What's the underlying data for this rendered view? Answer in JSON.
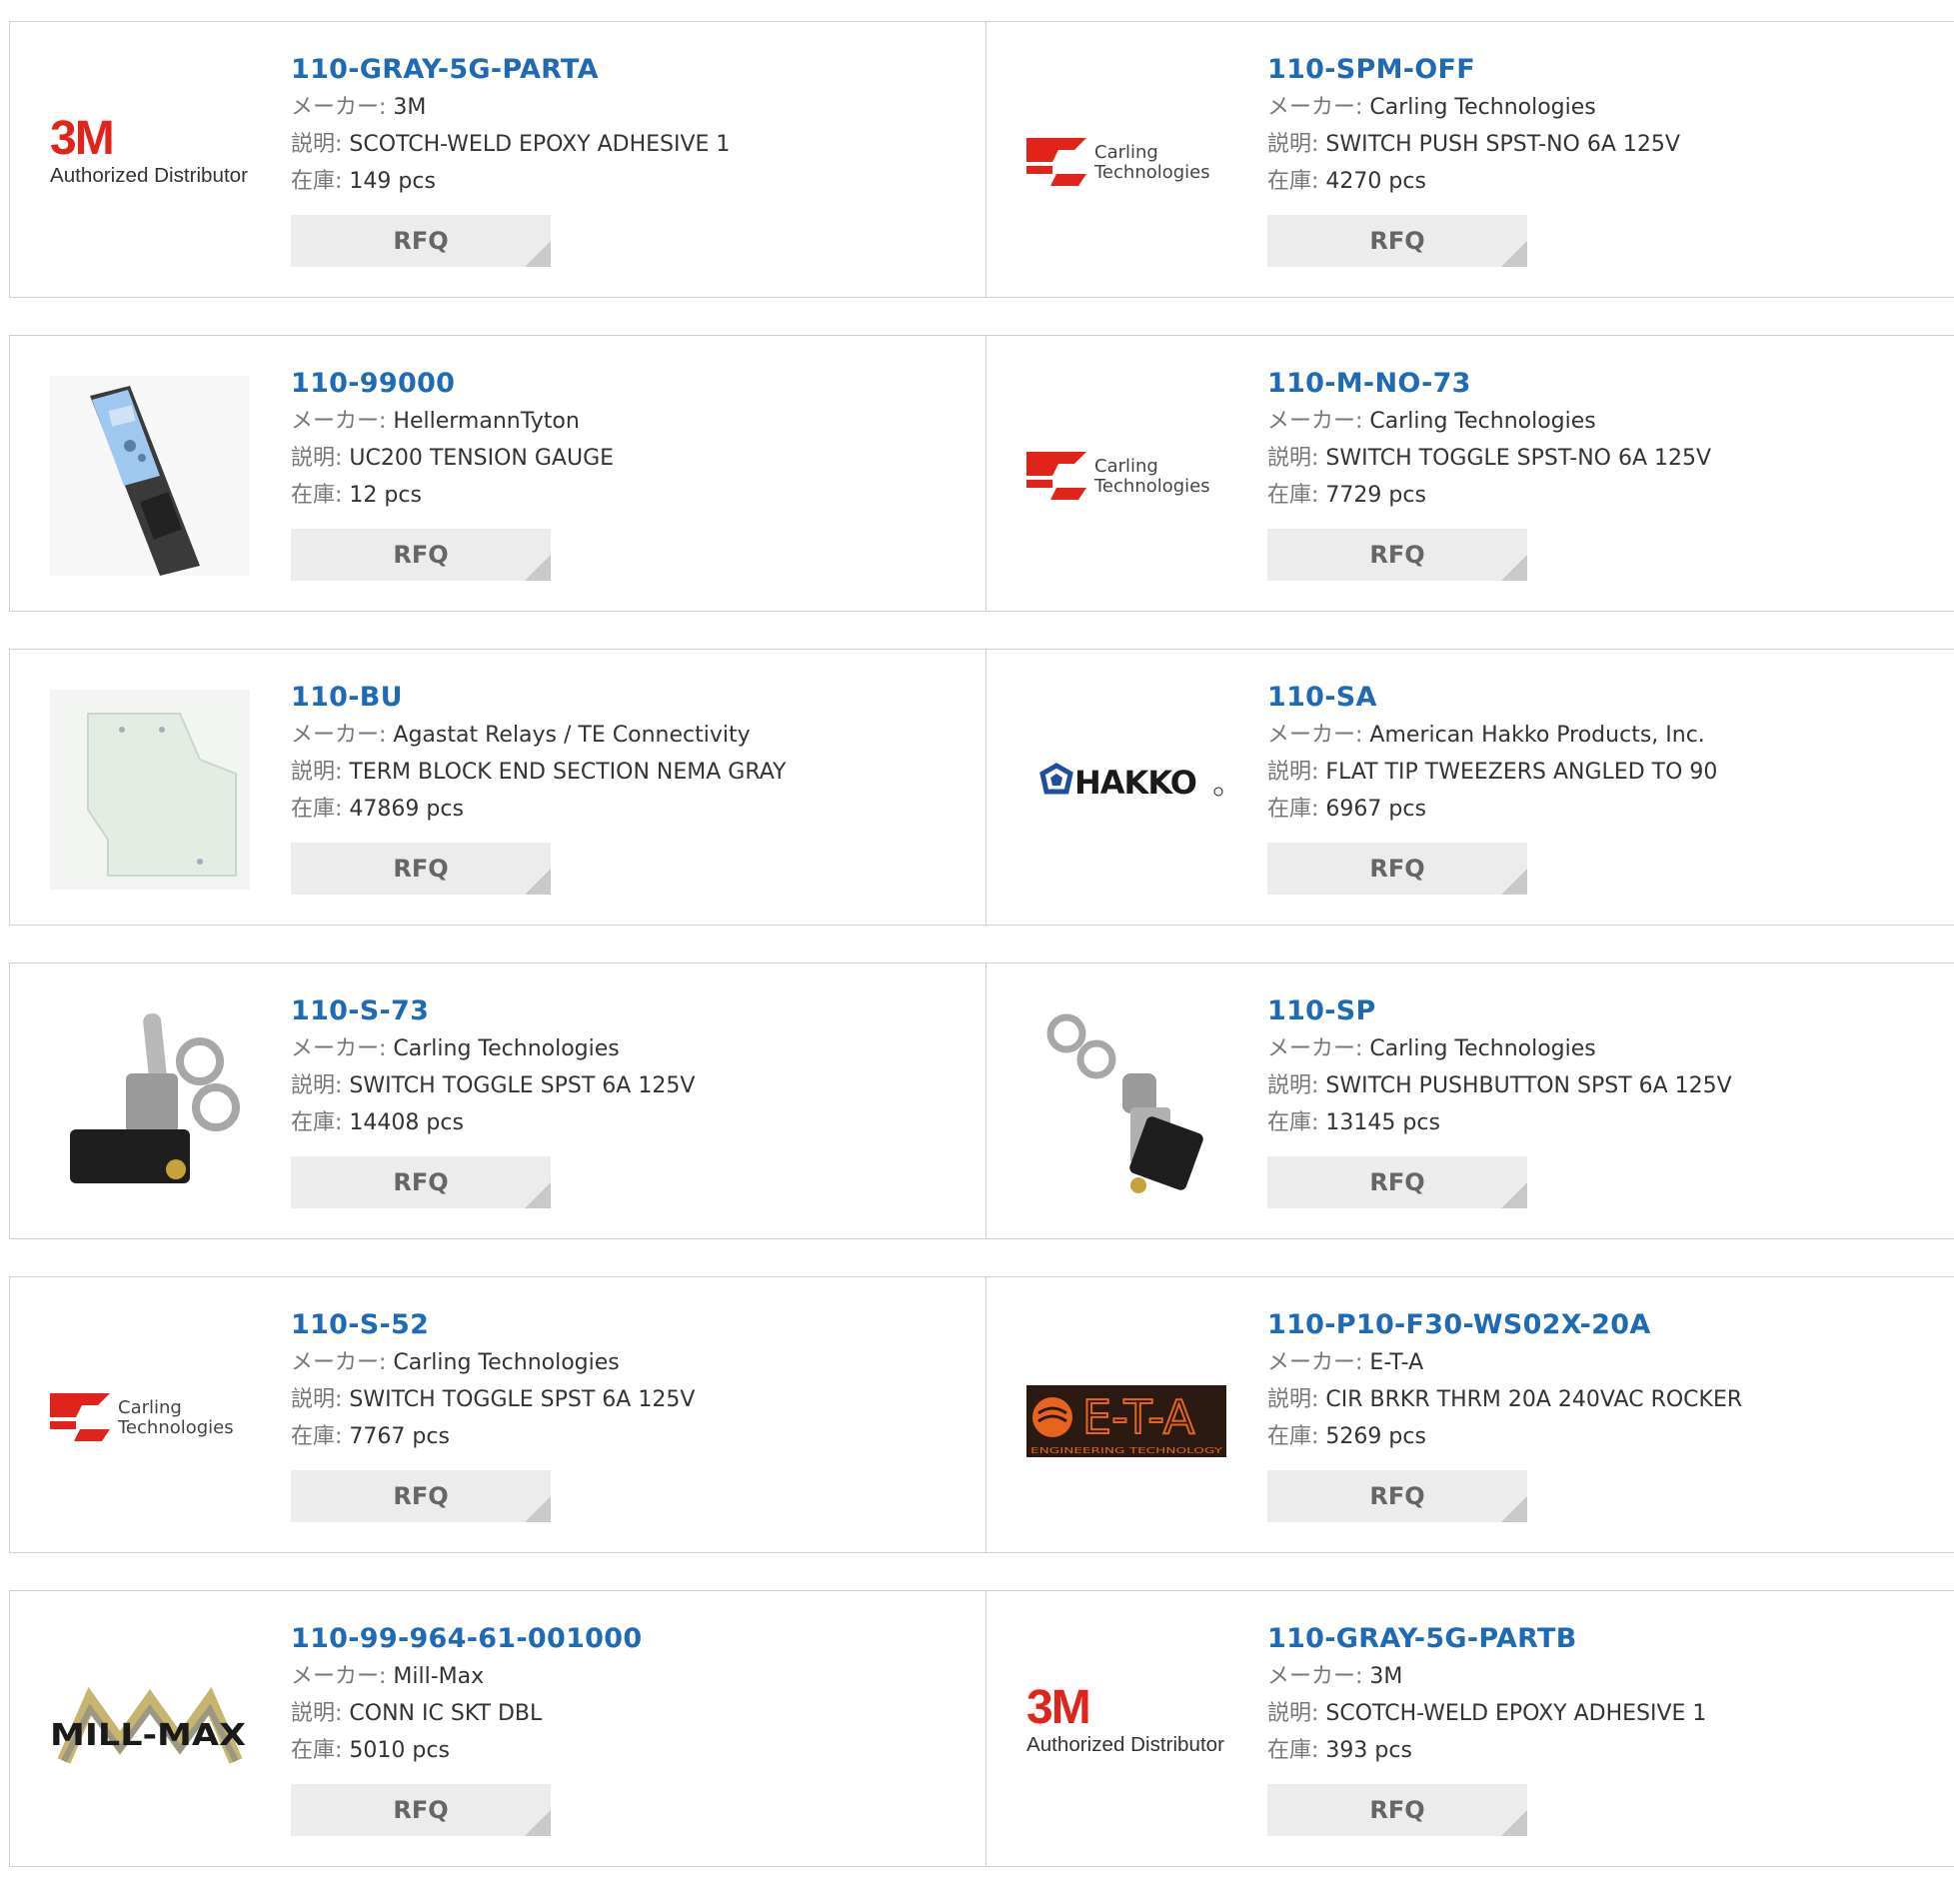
{
  "labels": {
    "maker": "メーカー:",
    "desc": "説明:",
    "stock": "在庫:",
    "rfq": "RFQ"
  },
  "logo_text": {
    "m3": "3M",
    "m3_sub": "Authorized Distributor",
    "carling1": "Carling",
    "carling2": "Technologies",
    "hakko": "HAKKO",
    "eta": "E-T-A",
    "eta_sub": "ENGINEERING TECHNOLOGY",
    "millmax": "MILL-MAX"
  },
  "products": [
    {
      "part": "110-GRAY-5G-PARTA",
      "maker": "3M",
      "desc": "SCOTCH-WELD EPOXY ADHESIVE 1",
      "stock": "149 pcs",
      "image": "3m-logo"
    },
    {
      "part": "110-SPM-OFF",
      "maker": "Carling Technologies",
      "desc": "SWITCH PUSH SPST-NO 6A 125V",
      "stock": "4270 pcs",
      "image": "carling-logo"
    },
    {
      "part": "110-99000",
      "maker": "HellermannTyton",
      "desc": "UC200 TENSION GAUGE",
      "stock": "12 pcs",
      "image": "tension-gauge-photo"
    },
    {
      "part": "110-M-NO-73",
      "maker": "Carling Technologies",
      "desc": "SWITCH TOGGLE SPST-NO 6A 125V",
      "stock": "7729 pcs",
      "image": "carling-logo"
    },
    {
      "part": "110-BU",
      "maker": "Agastat Relays / TE Connectivity",
      "desc": "TERM BLOCK END SECTION NEMA GRAY",
      "stock": "47869 pcs",
      "image": "end-section-photo"
    },
    {
      "part": "110-SA",
      "maker": "American Hakko Products, Inc.",
      "desc": "FLAT TIP TWEEZERS ANGLED TO 90",
      "stock": "6967 pcs",
      "image": "hakko-logo"
    },
    {
      "part": "110-S-73",
      "maker": "Carling Technologies",
      "desc": "SWITCH TOGGLE SPST 6A 125V",
      "stock": "14408 pcs",
      "image": "toggle-switch-photo"
    },
    {
      "part": "110-SP",
      "maker": "Carling Technologies",
      "desc": "SWITCH PUSHBUTTON SPST 6A 125V",
      "stock": "13145 pcs",
      "image": "pushbutton-switch-photo"
    },
    {
      "part": "110-S-52",
      "maker": "Carling Technologies",
      "desc": "SWITCH TOGGLE SPST 6A 125V",
      "stock": "7767 pcs",
      "image": "carling-logo"
    },
    {
      "part": "110-P10-F30-WS02X-20A",
      "maker": "E-T-A",
      "desc": "CIR BRKR THRM 20A 240VAC ROCKER",
      "stock": "5269 pcs",
      "image": "eta-logo"
    },
    {
      "part": "110-99-964-61-001000",
      "maker": "Mill-Max",
      "desc": "CONN IC SKT DBL",
      "stock": "5010 pcs",
      "image": "millmax-logo"
    },
    {
      "part": "110-GRAY-5G-PARTB",
      "maker": "3M",
      "desc": "SCOTCH-WELD EPOXY ADHESIVE 1",
      "stock": "393 pcs",
      "image": "3m-logo"
    }
  ],
  "colors": {
    "link": "#1f6ab5",
    "m3_red": "#e2231a",
    "carling_red": "#e2231a",
    "hakko_blue": "#1f4e9e",
    "eta_orange": "#e8641e",
    "button_bg": "#ececec"
  }
}
